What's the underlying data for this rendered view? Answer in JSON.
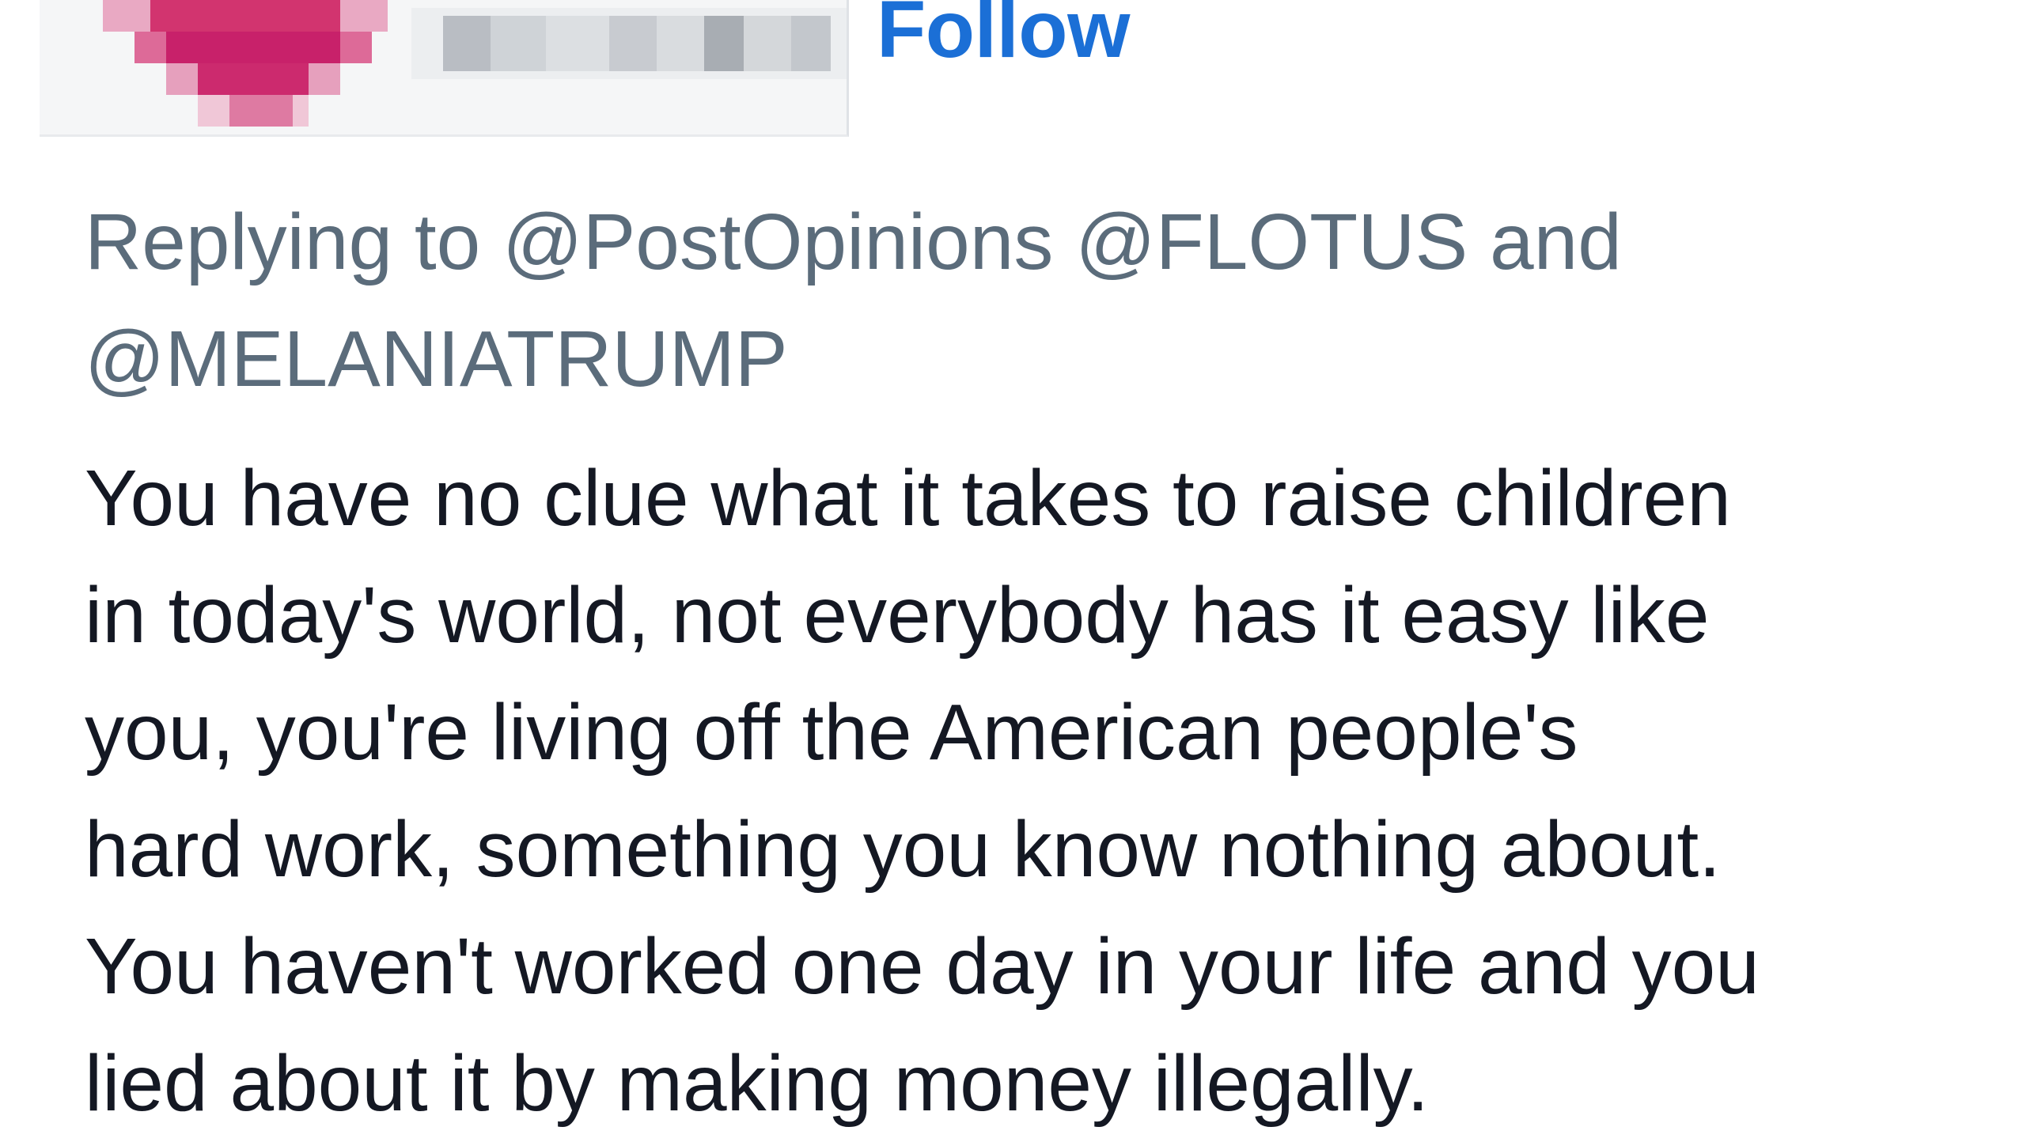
{
  "header": {
    "follow_label": "Follow"
  },
  "reply_context": {
    "prefix": "Replying to",
    "mentions": [
      "@PostOpinions",
      "@FLOTUS",
      "@MELANIATRUMP"
    ],
    "conjunction": "and"
  },
  "tweet": {
    "lines": [
      "You have no clue what it takes to raise children",
      "in today's world, not everybody has it easy like",
      "you, you're living off the American people's",
      "hard work, something you know nothing about.",
      "You haven't worked one day in your life and you",
      "lied about it by making money illegally."
    ]
  },
  "colors": {
    "follow": "#1b6fd6",
    "reply_context": "#5b6c7b",
    "body_text": "#141823",
    "avatar_pixels": "#c7246a"
  },
  "icons": {
    "avatar": "pixelated-avatar"
  }
}
